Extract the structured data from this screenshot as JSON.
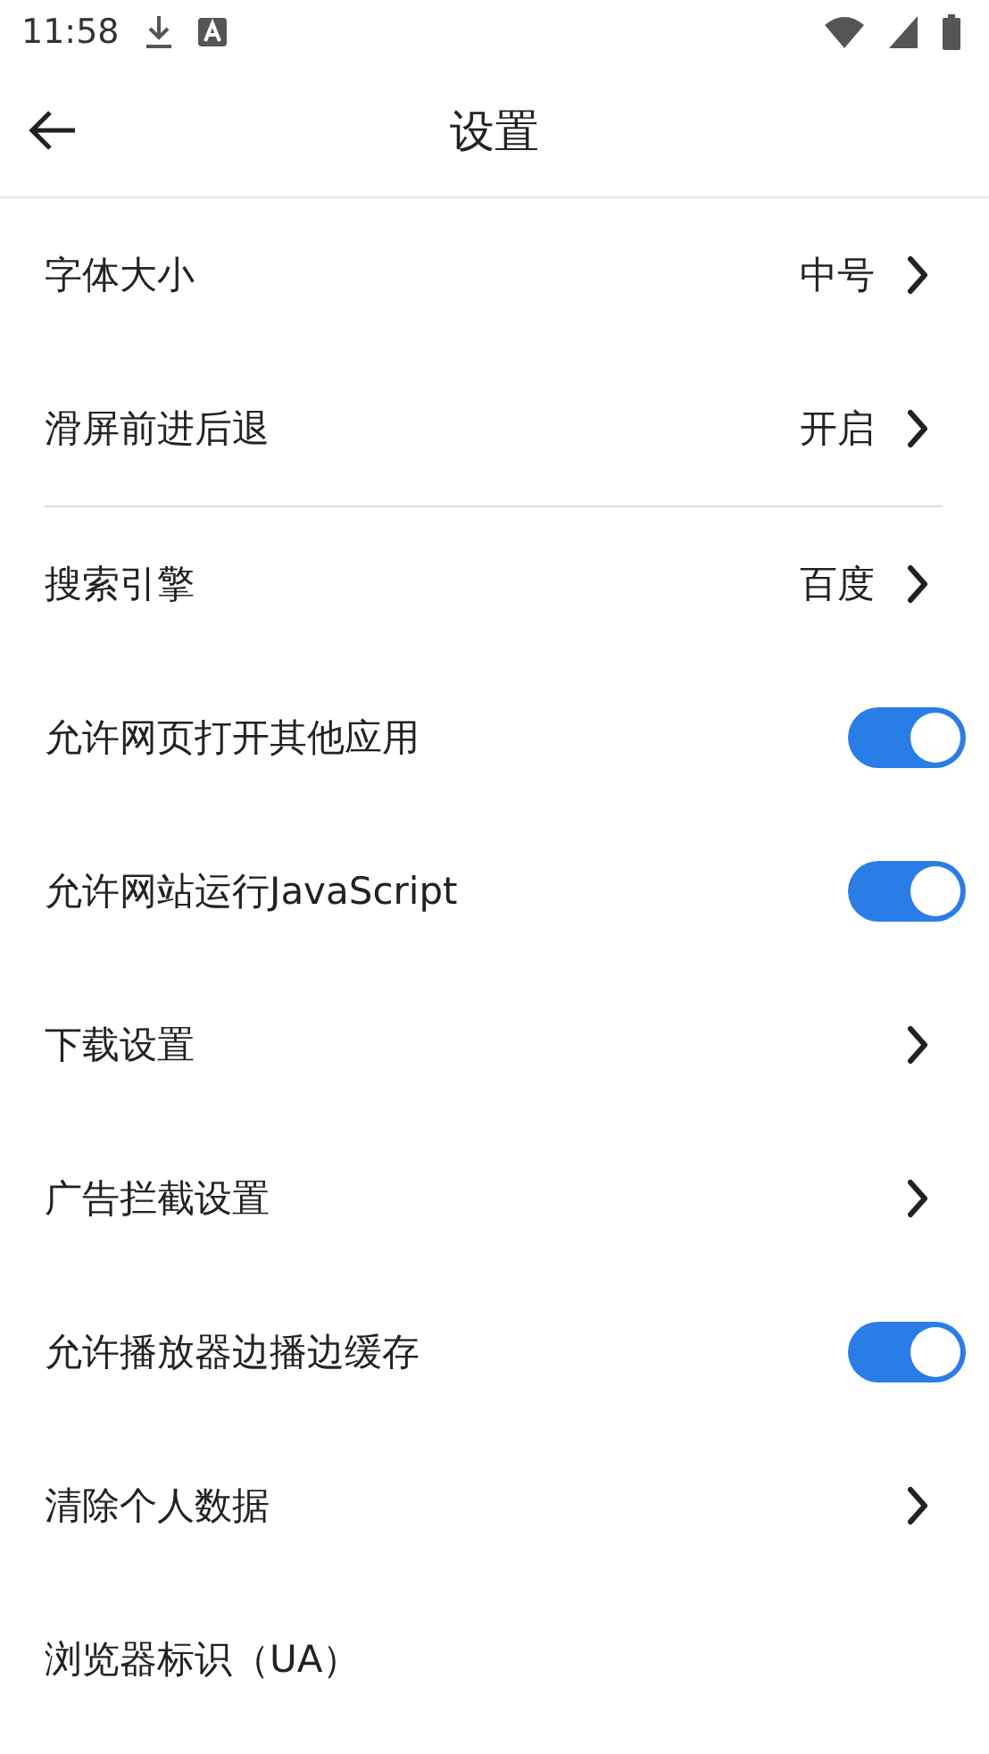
{
  "status_bar": {
    "time": "11:58"
  },
  "header": {
    "title": "设置"
  },
  "groups": [
    [
      {
        "kind": "value",
        "label": "字体大小",
        "value": "中号"
      },
      {
        "kind": "value",
        "label": "滑屏前进后退",
        "value": "开启"
      }
    ],
    [
      {
        "kind": "value",
        "label": "搜索引擎",
        "value": "百度"
      },
      {
        "kind": "toggle",
        "label": "允许网页打开其他应用",
        "on": true
      },
      {
        "kind": "toggle",
        "label": "允许网站运行JavaScript",
        "on": true
      },
      {
        "kind": "link",
        "label": "下载设置"
      },
      {
        "kind": "link",
        "label": "广告拦截设置"
      },
      {
        "kind": "toggle",
        "label": "允许播放器边播边缓存",
        "on": true
      },
      {
        "kind": "link",
        "label": "清除个人数据"
      },
      {
        "kind": "plain",
        "label": "浏览器标识（UA）"
      }
    ]
  ]
}
